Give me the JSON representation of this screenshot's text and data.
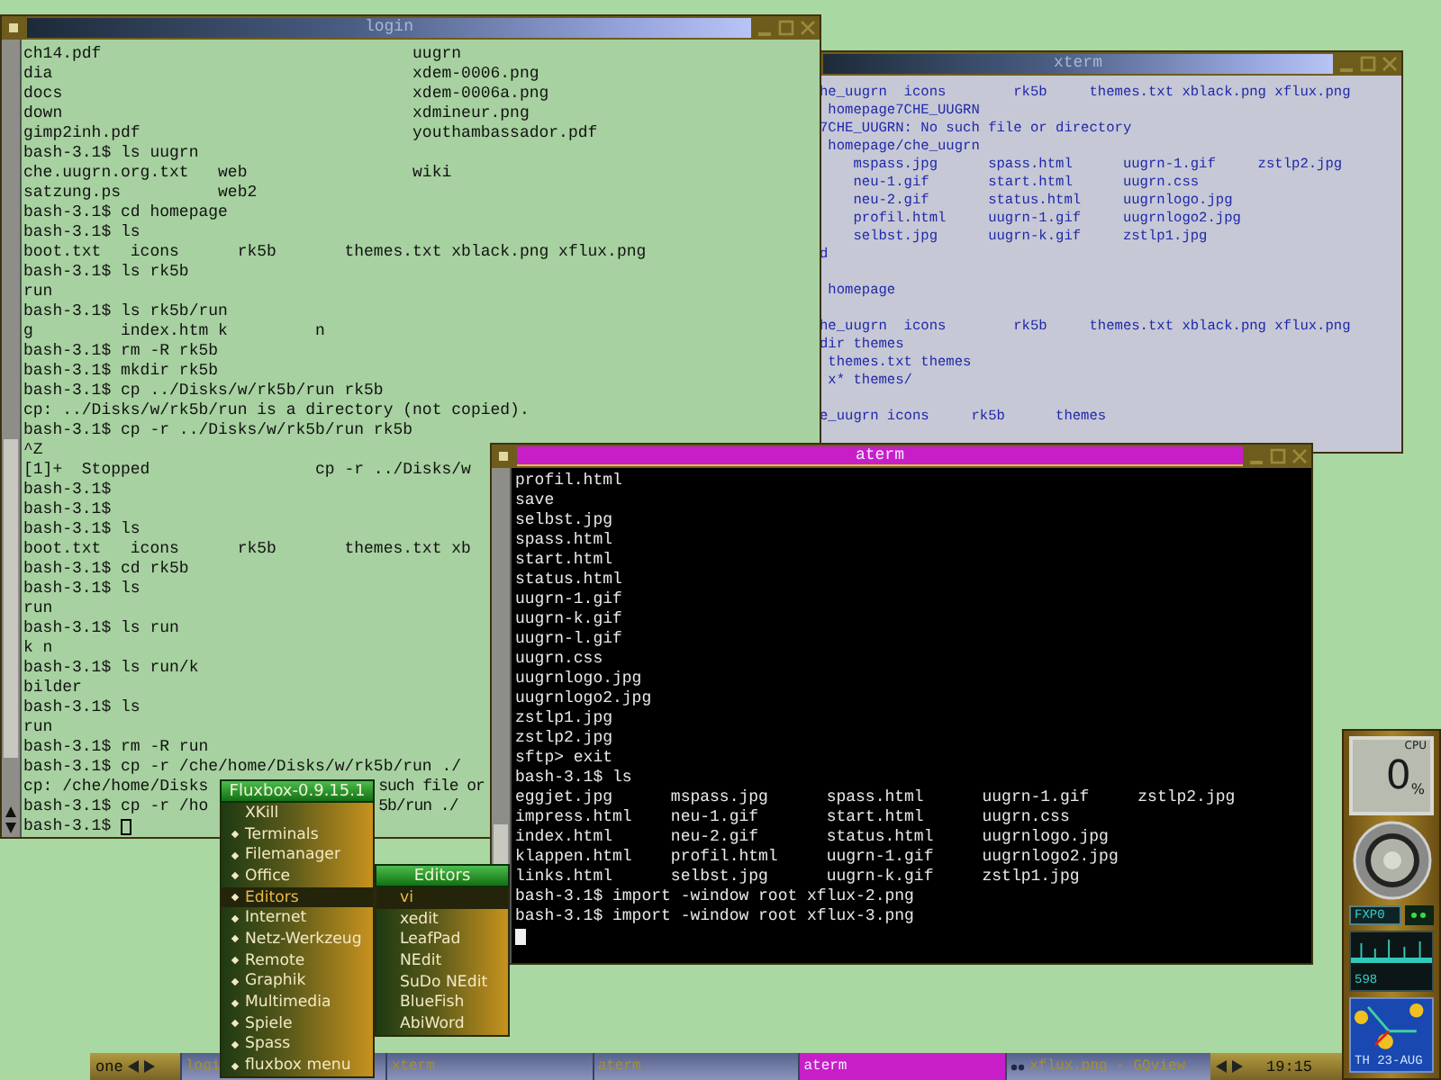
{
  "login_window": {
    "title": "login",
    "focused": false,
    "lines": [
      {
        "text": "ch14.pdf                                uugrn"
      },
      {
        "text": "dia                                     xdem-0006.png"
      },
      {
        "text": "docs                                    xdem-0006a.png"
      },
      {
        "text": "down                                    xdmineur.png"
      },
      {
        "text": "gimp2inh.pdf                            youthambassador.pdf"
      },
      {
        "text": "bash-3.1$ ls uugrn"
      },
      {
        "text": "che.uugrn.org.txt   web                 wiki"
      },
      {
        "text": "satzung.ps          web2"
      },
      {
        "text": "bash-3.1$ cd homepage"
      },
      {
        "text": "bash-3.1$ ls"
      },
      {
        "text": "boot.txt   icons      rk5b       themes.txt xblack.png xflux.png"
      },
      {
        "text": "bash-3.1$ ls rk5b"
      },
      {
        "text": "run"
      },
      {
        "text": "bash-3.1$ ls rk5b/run"
      },
      {
        "text": "g         index.htm k         n"
      },
      {
        "text": "bash-3.1$ rm -R rk5b"
      },
      {
        "text": "bash-3.1$ mkdir rk5b"
      },
      {
        "text": "bash-3.1$ cp ../Disks/w/rk5b/run rk5b"
      },
      {
        "text": "cp: ../Disks/w/rk5b/run is a directory (not copied)."
      },
      {
        "text": "bash-3.1$ cp -r ../Disks/w/rk5b/run rk5b"
      },
      {
        "text": "^Z"
      },
      {
        "text": "[1]+  Stopped                 cp -r ../Disks/w"
      },
      {
        "text": "bash-3.1$"
      },
      {
        "text": "bash-3.1$"
      },
      {
        "text": "bash-3.1$ ls"
      },
      {
        "text": "boot.txt   icons      rk5b       themes.txt xb"
      },
      {
        "text": "bash-3.1$ cd rk5b"
      },
      {
        "text": "bash-3.1$ ls"
      },
      {
        "text": "run"
      },
      {
        "text": "bash-3.1$ ls run"
      },
      {
        "text": "k n"
      },
      {
        "text": "bash-3.1$ ls run/k"
      },
      {
        "text": "bilder"
      },
      {
        "text": "bash-3.1$ ls"
      },
      {
        "text": "run"
      },
      {
        "text": "bash-3.1$ rm -R run"
      },
      {
        "text": "bash-3.1$ cp -r /che/home/Disks/w/rk5b/run ./"
      },
      {
        "text": "cp: /che/home/Disks",
        "after_menu": "such file or"
      },
      {
        "text": "bash-3.1$ cp -r /ho",
        "after_menu": "5b/run ./"
      }
    ],
    "prompt": "bash-3.1$"
  },
  "xterm_window": {
    "title": "xterm",
    "focused": false,
    "blocks": [
      [
        "he_uugrn  icons        rk5b     themes.txt xblack.png xflux.png",
        " homepage7CHE_UUGRN",
        "7CHE_UUGRN: No such file or directory",
        " homepage/che_uugrn",
        "    mspass.jpg      spass.html      uugrn-1.gif     zstlp2.jpg",
        "    neu-1.gif       start.html      uugrn.css",
        "    neu-2.gif       status.html     uugrnlogo.jpg",
        "    profil.html     uugrn-1.gif     uugrnlogo2.jpg",
        "    selbst.jpg      uugrn-k.gif     zstlp1.jpg",
        "d"
      ],
      [
        " homepage"
      ],
      [
        "he_uugrn  icons        rk5b     themes.txt xblack.png xflux.png",
        "dir themes",
        " themes.txt themes",
        " x* themes/"
      ],
      [
        "e_uugrn icons     rk5b      themes"
      ]
    ]
  },
  "aterm_window": {
    "title": "aterm",
    "focused": true,
    "lines": [
      "profil.html",
      "save",
      "selbst.jpg",
      "spass.html",
      "start.html",
      "status.html",
      "uugrn-1.gif",
      "uugrn-k.gif",
      "uugrn-l.gif",
      "uugrn.css",
      "uugrnlogo.jpg",
      "uugrnlogo2.jpg",
      "zstlp1.jpg",
      "zstlp2.jpg",
      "sftp> exit",
      "bash-3.1$ ls",
      "eggjet.jpg      mspass.jpg      spass.html      uugrn-1.gif     zstlp2.jpg",
      "impress.html    neu-1.gif       start.html      uugrn.css",
      "index.html      neu-2.gif       status.html     uugrnlogo.jpg",
      "klappen.html    profil.html     uugrn-1.gif     uugrnlogo2.jpg",
      "links.html      selbst.jpg      uugrn-k.gif     zstlp1.jpg",
      "bash-3.1$ import -window root xflux-2.png",
      "bash-3.1$ import -window root xflux-3.png"
    ]
  },
  "root_menu": {
    "title": "Fluxbox-0.9.15.1",
    "items": [
      {
        "label": "XKill",
        "submenu": false,
        "selected": false
      },
      {
        "label": "Terminals",
        "submenu": true,
        "selected": false
      },
      {
        "label": "Filemanager",
        "submenu": true,
        "selected": false
      },
      {
        "label": "Office",
        "submenu": true,
        "selected": false
      },
      {
        "label": "Editors",
        "submenu": true,
        "selected": true
      },
      {
        "label": "Internet",
        "submenu": true,
        "selected": false
      },
      {
        "label": "Netz-Werkzeug",
        "submenu": true,
        "selected": false
      },
      {
        "label": "Remote",
        "submenu": true,
        "selected": false
      },
      {
        "label": "Graphik",
        "submenu": true,
        "selected": false
      },
      {
        "label": "Multimedia",
        "submenu": true,
        "selected": false
      },
      {
        "label": "Spiele",
        "submenu": true,
        "selected": false
      },
      {
        "label": "Spass",
        "submenu": true,
        "selected": false
      },
      {
        "label": "fluxbox menu",
        "submenu": true,
        "selected": false
      }
    ]
  },
  "editors_menu": {
    "title": "Editors",
    "items": [
      {
        "label": "vi",
        "selected": true
      },
      {
        "label": "xedit",
        "selected": false
      },
      {
        "label": "LeafPad",
        "selected": false
      },
      {
        "label": "NEdit",
        "selected": false
      },
      {
        "label": "SuDo NEdit",
        "selected": false
      },
      {
        "label": "BlueFish",
        "selected": false
      },
      {
        "label": "AbiWord",
        "selected": false
      }
    ]
  },
  "taskbar": {
    "workspace": "one",
    "tasks": [
      {
        "label": "logi",
        "kind": "terminal",
        "selected": false
      },
      {
        "label": "xterm",
        "kind": "terminal",
        "selected": false
      },
      {
        "label": "aterm",
        "kind": "terminal",
        "selected": false
      },
      {
        "label": "aterm",
        "kind": "terminal",
        "selected": true
      },
      {
        "label": "xflux.png - GQview",
        "kind": "viewer",
        "selected": false
      }
    ],
    "clock": "19:15"
  },
  "dock": {
    "cpu_value": "0",
    "cpu_unit": "%",
    "cpu_label": "CPU",
    "interface": "FXP0",
    "net_reading": "598",
    "date": "TH 23-AUG"
  }
}
